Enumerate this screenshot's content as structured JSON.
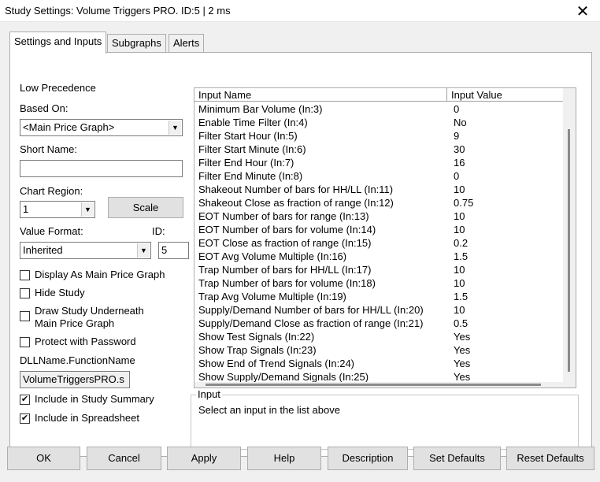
{
  "window": {
    "title": "Study Settings: Volume Triggers PRO. ID:5 | 2 ms",
    "close_label": "✕"
  },
  "tabs": [
    "Settings and Inputs",
    "Subgraphs",
    "Alerts"
  ],
  "left": {
    "precedence": "Low Precedence",
    "based_on_label": "Based On:",
    "based_on_value": "<Main Price Graph>",
    "short_name_label": "Short Name:",
    "short_name_value": "",
    "chart_region_label": "Chart Region:",
    "chart_region_value": "1",
    "scale_button": "Scale",
    "value_format_label": "Value Format:",
    "value_format_value": "Inherited",
    "id_label": "ID:",
    "id_value": "5",
    "display_main_price": "Display As Main Price Graph",
    "hide_study": "Hide Study",
    "draw_underneath_1": "Draw Study Underneath",
    "draw_underneath_2": "Main Price Graph",
    "protect_password": "Protect with Password",
    "dll_label": "DLLName.FunctionName",
    "dll_value": "VolumeTriggersPRO.s",
    "include_summary": "Include in Study Summary",
    "include_spreadsheet": "Include in Spreadsheet"
  },
  "grid": {
    "col_name": "Input Name",
    "col_value": "Input Value",
    "rows": [
      {
        "name": "Minimum Bar Volume  (In:3)",
        "value": "0"
      },
      {
        "name": "Enable Time Filter  (In:4)",
        "value": "No"
      },
      {
        "name": "Filter Start Hour  (In:5)",
        "value": "9"
      },
      {
        "name": "Filter Start Minute  (In:6)",
        "value": "30"
      },
      {
        "name": "Filter End Hour  (In:7)",
        "value": "16"
      },
      {
        "name": "Filter End Minute  (In:8)",
        "value": "0"
      },
      {
        "name": "Shakeout Number of bars for HH/LL  (In:11)",
        "value": "10"
      },
      {
        "name": "Shakeout Close as fraction of range  (In:12)",
        "value": "0.75"
      },
      {
        "name": "EOT Number of bars for range  (In:13)",
        "value": "10"
      },
      {
        "name": "EOT Number of bars for volume  (In:14)",
        "value": "10"
      },
      {
        "name": "EOT Close as fraction of range  (In:15)",
        "value": "0.2"
      },
      {
        "name": "EOT Avg Volume Multiple  (In:16)",
        "value": "1.5"
      },
      {
        "name": "Trap Number of bars for HH/LL  (In:17)",
        "value": "10"
      },
      {
        "name": "Trap Number of bars for volume  (In:18)",
        "value": "10"
      },
      {
        "name": "Trap Avg Volume Multiple  (In:19)",
        "value": "1.5"
      },
      {
        "name": "Supply/Demand Number of bars for HH/LL  (In:20)",
        "value": "10"
      },
      {
        "name": "Supply/Demand Close as fraction of range  (In:21)",
        "value": "0.5"
      },
      {
        "name": "Show Test Signals  (In:22)",
        "value": "Yes"
      },
      {
        "name": "Show Trap Signals  (In:23)",
        "value": "Yes"
      },
      {
        "name": "Show End of Trend Signals  (In:24)",
        "value": "Yes"
      },
      {
        "name": "Show Supply/Demand Signals  (In:25)",
        "value": "Yes"
      }
    ]
  },
  "input_group": {
    "legend": "Input",
    "description": "Select an input in the list above"
  },
  "buttons": [
    "OK",
    "Cancel",
    "Apply",
    "Help",
    "Description",
    "Set Defaults",
    "Reset Defaults"
  ],
  "checks": {
    "display_main_price": false,
    "hide_study": false,
    "draw_underneath": false,
    "protect_password": false,
    "include_summary": true,
    "include_spreadsheet": true
  },
  "icons": {
    "close": "close-icon",
    "dropdown": "chevron-down-icon",
    "check": "checkmark-icon"
  }
}
